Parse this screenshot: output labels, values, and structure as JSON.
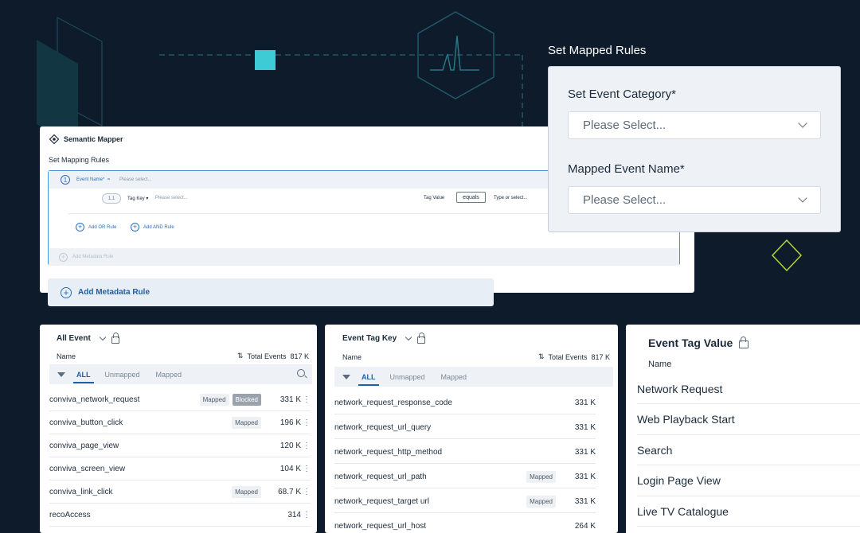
{
  "semantic_mapper": {
    "title": "Semantic Mapper",
    "subtitle": "Set Mapping Rules",
    "rule": {
      "number": "1",
      "event_label": "Event Name*",
      "event_operator": "=",
      "event_placeholder": "Please select...",
      "sub_number": "1.1",
      "tag_key_label": "Tag Key",
      "tag_key_placeholder": "Please select...",
      "tag_value_label": "Tag Value",
      "operator": "equals",
      "value_placeholder": "Type or select...",
      "add_or": "Add OR Rule",
      "add_and": "Add AND Rule",
      "add_metadata_inner": "Add Metadata Rule"
    },
    "add_metadata": "Add Metadata Rule"
  },
  "set_mapped_rules": {
    "title": "Set Mapped Rules",
    "category_label": "Set Event Category*",
    "category_placeholder": "Please Select...",
    "name_label": "Mapped Event Name*",
    "name_placeholder": "Please Select..."
  },
  "all_event": {
    "title": "All Event",
    "col_name": "Name",
    "total_label": "Total Events",
    "total_value": "817 K",
    "tabs": [
      "ALL",
      "Unmapped",
      "Mapped"
    ],
    "rows": [
      {
        "name": "conviva_network_request",
        "badges": [
          "Mapped",
          "Blocked"
        ],
        "count": "331 K"
      },
      {
        "name": "conviva_button_click",
        "badges": [
          "Mapped"
        ],
        "count": "196 K"
      },
      {
        "name": "conviva_page_view",
        "badges": [],
        "count": "120 K"
      },
      {
        "name": "conviva_screen_view",
        "badges": [],
        "count": "104 K"
      },
      {
        "name": "conviva_link_click",
        "badges": [
          "Mapped"
        ],
        "count": "68.7 K"
      },
      {
        "name": "recoAccess",
        "badges": [],
        "count": "314"
      }
    ]
  },
  "event_tag_key": {
    "title": "Event Tag Key",
    "col_name": "Name",
    "total_label": "Total Events",
    "total_value": "817 K",
    "tabs": [
      "ALL",
      "Unmapped",
      "Mapped"
    ],
    "rows": [
      {
        "name": "network_request_response_code",
        "badges": [],
        "count": "331 K"
      },
      {
        "name": "network_request_url_query",
        "badges": [],
        "count": "331 K"
      },
      {
        "name": "network_request_http_method",
        "badges": [],
        "count": "331 K"
      },
      {
        "name": "network_request_url_path",
        "badges": [
          "Mapped"
        ],
        "count": "331 K"
      },
      {
        "name": "network_request_target url",
        "badges": [
          "Mapped"
        ],
        "count": "331 K"
      },
      {
        "name": "network_request_url_host",
        "badges": [],
        "count": "264 K"
      }
    ]
  },
  "event_tag_value": {
    "title": "Event Tag Value",
    "col_name": "Name",
    "rows": [
      "Network Request",
      "Web Playback Start",
      "Search",
      "Login Page View",
      "Live TV Catalogue"
    ]
  },
  "colors": {
    "background": "#0d1b2a",
    "accent_blue": "#1f5fa8",
    "teal": "#3ecbd6",
    "lime": "#b5d334"
  }
}
